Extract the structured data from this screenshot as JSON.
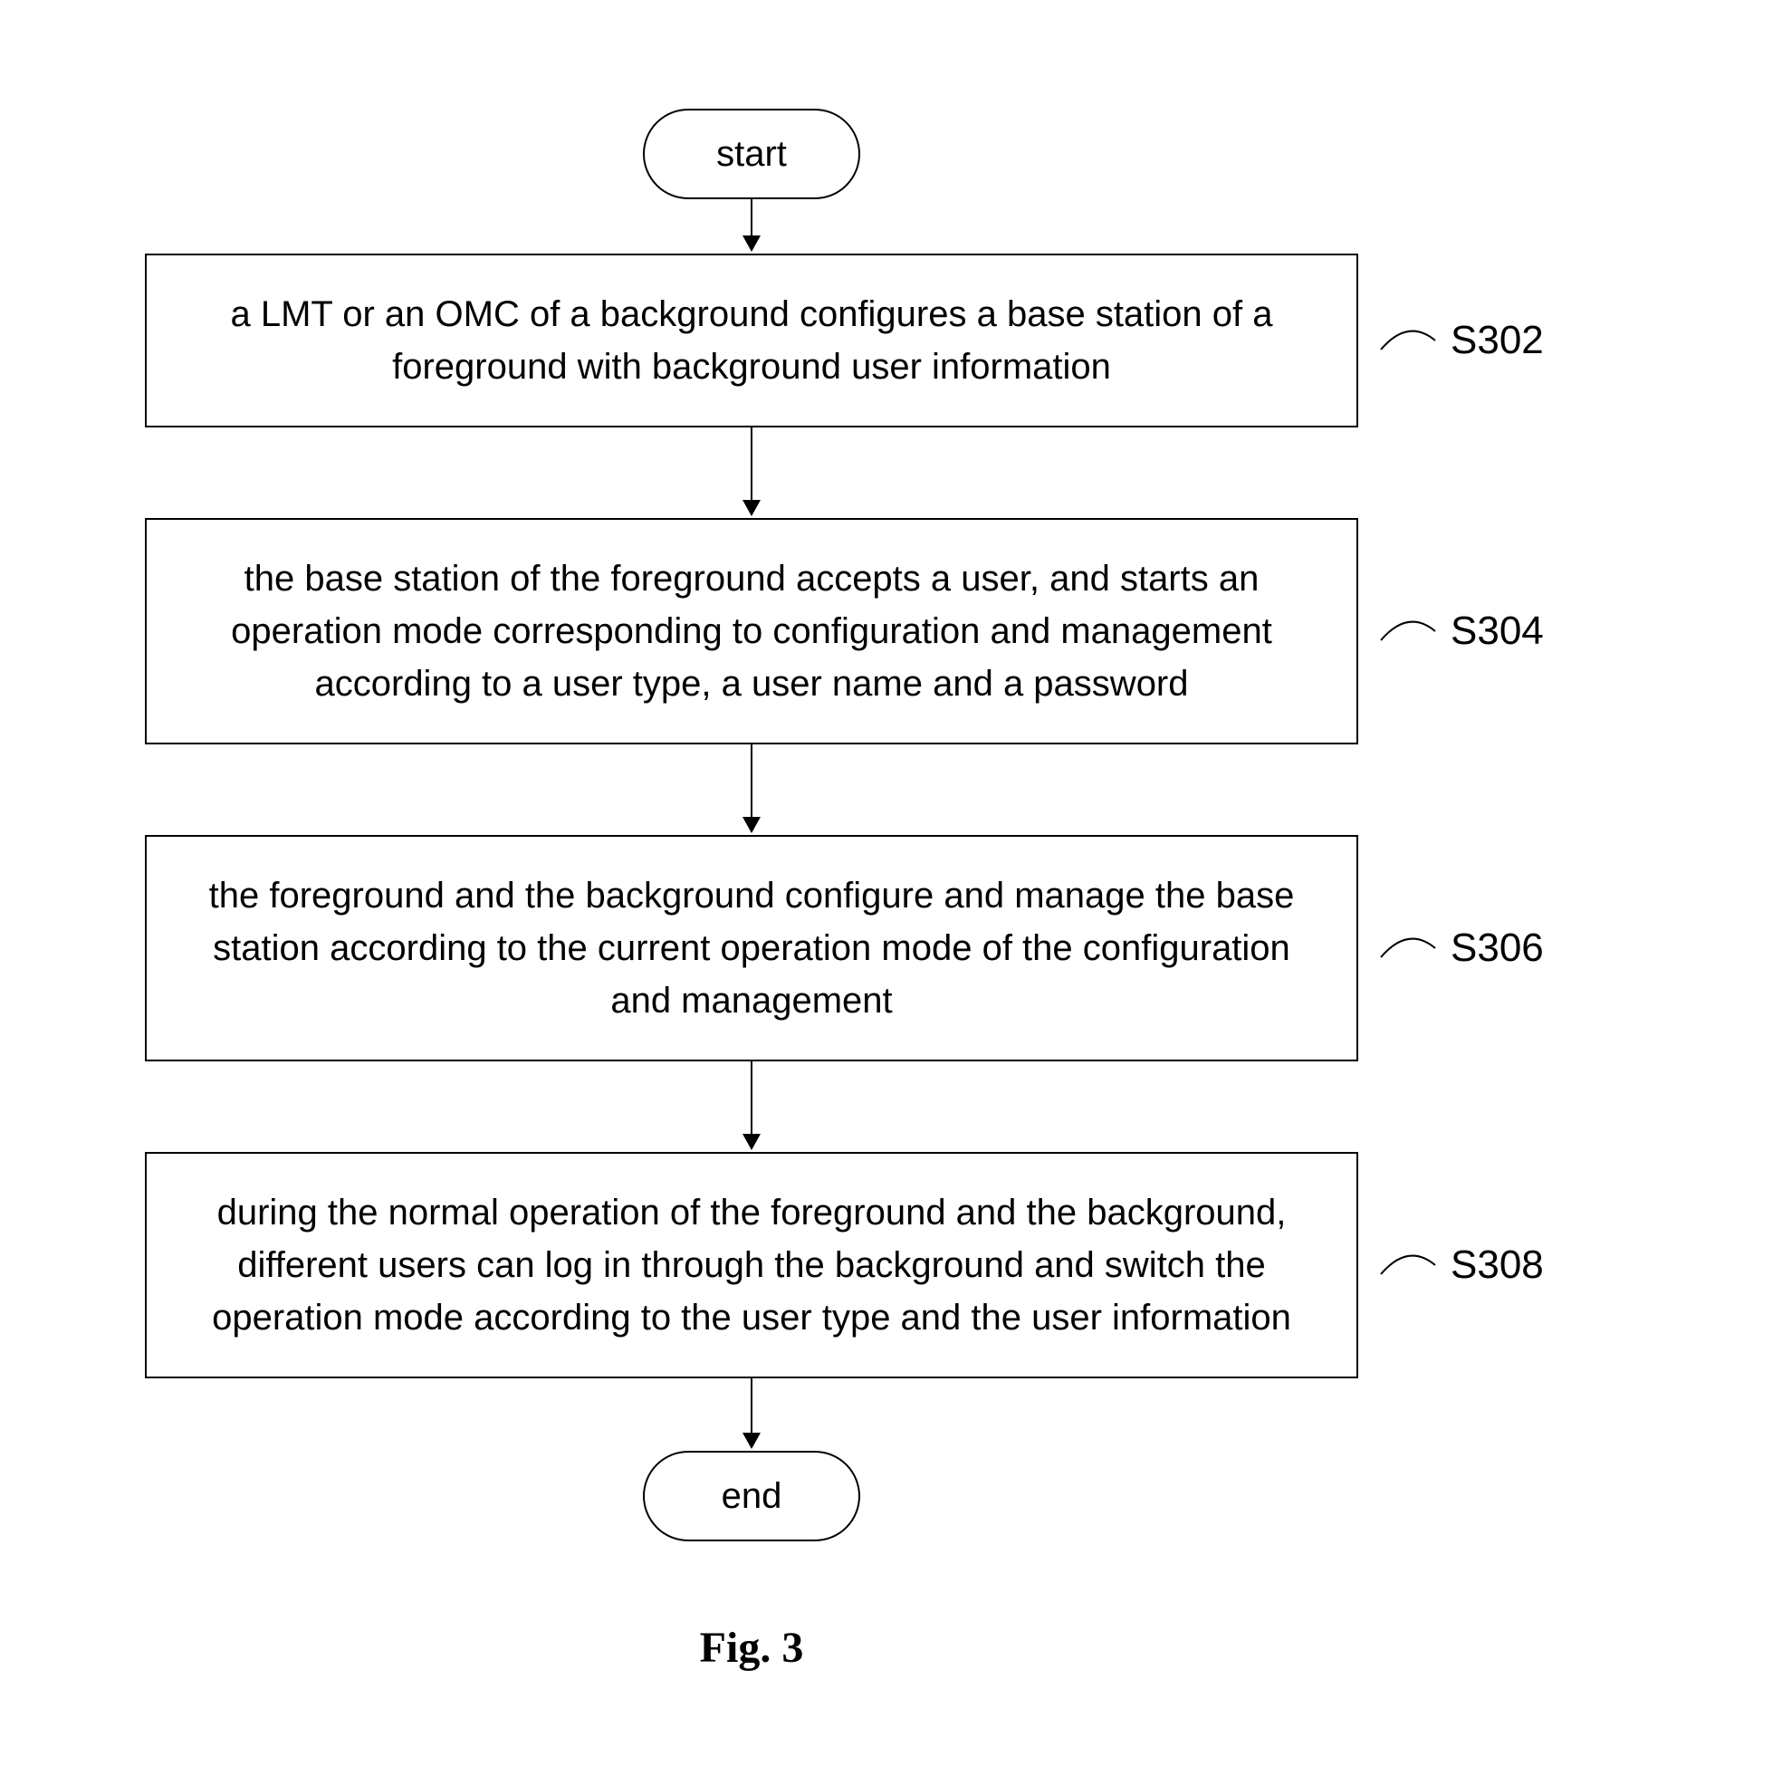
{
  "terminals": {
    "start": "start",
    "end": "end"
  },
  "steps": [
    {
      "id": "S302",
      "text": "a LMT or an OMC of a background configures a base station of a foreground with background user information"
    },
    {
      "id": "S304",
      "text": "the base station of the foreground accepts a user, and starts an operation mode corresponding to configuration and management according to a user type, a user name and a password"
    },
    {
      "id": "S306",
      "text": "the foreground and the background configure and manage the base station according to the current operation mode of the configuration and management"
    },
    {
      "id": "S308",
      "text": "during the normal operation of the foreground and the background, different users can log in through the background and switch the operation mode according to the user type and the user information"
    }
  ],
  "caption": "Fig. 3"
}
